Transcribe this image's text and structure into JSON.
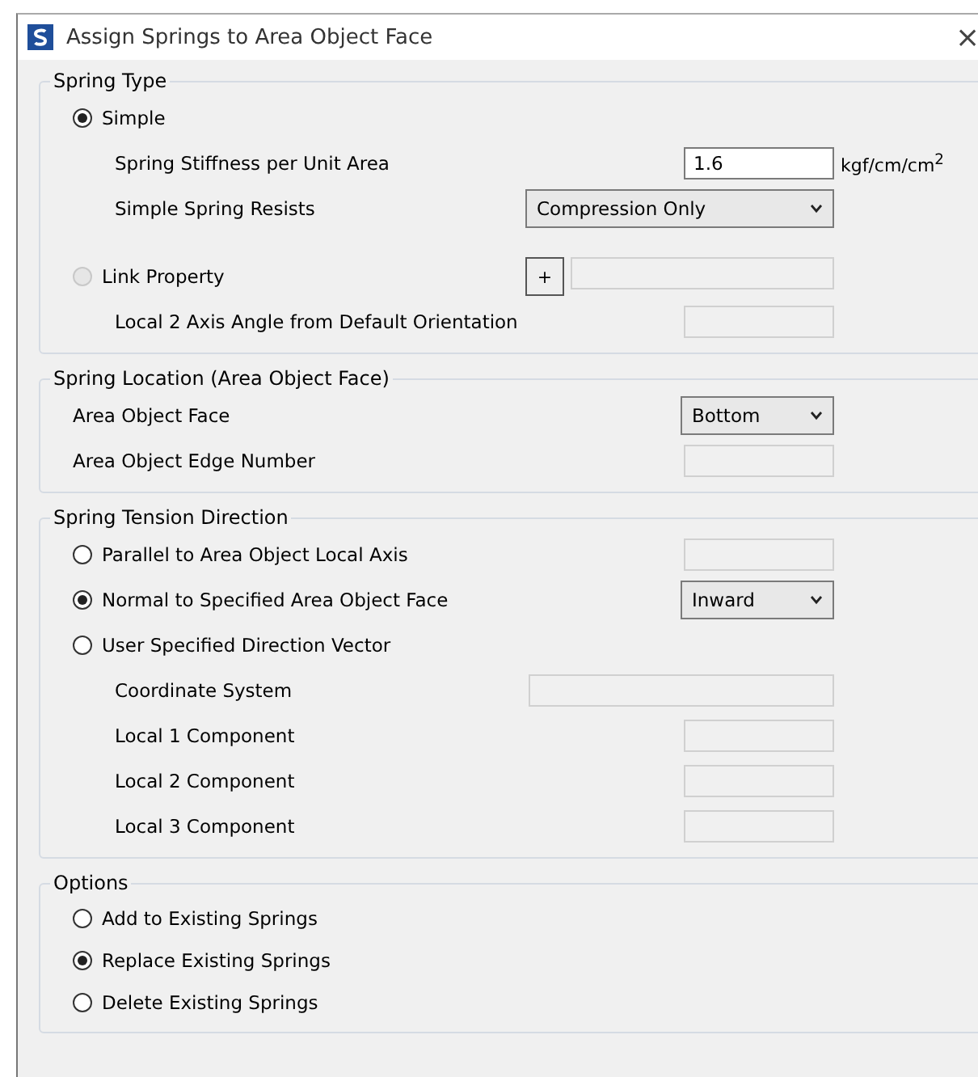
{
  "window": {
    "title": "Assign Springs to Area Object Face",
    "close": "×"
  },
  "groups": [
    {
      "title": "Spring Type",
      "rows": [
        {
          "kind": "radio",
          "label": "Simple",
          "selected": true,
          "disabled": false,
          "children": [
            {
              "kind": "label",
              "label": "Spring Stiffness per Unit Area",
              "control": {
                "kind": "text",
                "wide": false,
                "value": "1.6",
                "enabled": true
              },
              "units": "kgf/cm/cm$^{2}$"
            },
            {
              "kind": "label",
              "label": "Simple Spring Resists",
              "control": {
                "kind": "dropdown",
                "wide": true,
                "value": "Compression Only"
              }
            }
          ]
        },
        {
          "kind": "radio",
          "label": "Link Property",
          "selected": false,
          "disabled": true,
          "control": {
            "kind": "link",
            "button": "+"
          },
          "children": [
            {
              "kind": "label",
              "label": "Local 2 Axis Angle from Default Orientation",
              "control": {
                "kind": "text",
                "wide": false,
                "enabled": false
              }
            }
          ]
        }
      ]
    },
    {
      "title": "Spring Location (Area Object Face)",
      "rows": [
        {
          "kind": "label",
          "label": "Area Object Face",
          "control": {
            "kind": "dropdown",
            "wide": false,
            "value": "Bottom"
          }
        },
        {
          "kind": "label",
          "label": "Area Object Edge Number",
          "control": {
            "kind": "text",
            "wide": false,
            "enabled": false
          }
        }
      ]
    },
    {
      "title": "Spring Tension Direction",
      "rows": [
        {
          "kind": "radio",
          "label": "Parallel to Area Object Local Axis",
          "selected": false,
          "disabled": false,
          "control": {
            "kind": "text",
            "wide": false,
            "enabled": false
          }
        },
        {
          "kind": "radio",
          "label": "Normal to Specified Area Object Face",
          "selected": true,
          "disabled": false,
          "control": {
            "kind": "dropdown",
            "wide": false,
            "value": "Inward"
          }
        },
        {
          "kind": "radio",
          "label": "User Specified Direction Vector",
          "selected": false,
          "disabled": false,
          "children": [
            {
              "kind": "label",
              "label": "Coordinate System",
              "control": {
                "kind": "text",
                "wide": true,
                "enabled": false
              }
            },
            {
              "kind": "label",
              "label": "Local 1 Component",
              "control": {
                "kind": "text",
                "wide": false,
                "enabled": false
              }
            },
            {
              "kind": "label",
              "label": "Local 2 Component",
              "control": {
                "kind": "text",
                "wide": false,
                "enabled": false
              }
            },
            {
              "kind": "label",
              "label": "Local 3 Component",
              "control": {
                "kind": "text",
                "wide": false,
                "enabled": false
              }
            }
          ]
        }
      ]
    },
    {
      "title": "Options",
      "rows": [
        {
          "kind": "radio",
          "label": "Add to Existing Springs",
          "selected": false,
          "disabled": false
        },
        {
          "kind": "radio",
          "label": "Replace Existing Springs",
          "selected": true,
          "disabled": false
        },
        {
          "kind": "radio",
          "label": "Delete Existing Springs",
          "selected": false,
          "disabled": false
        }
      ]
    }
  ]
}
